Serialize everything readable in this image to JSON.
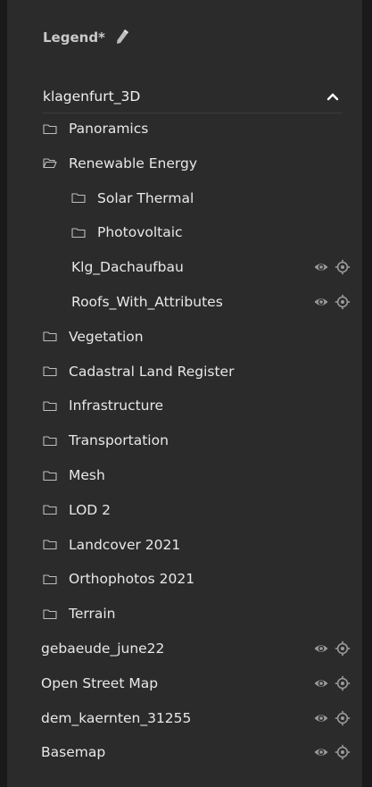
{
  "legend": {
    "title": "Legend*",
    "edit_icon": "pencil-icon"
  },
  "project": {
    "name": "klagenfurt_3D",
    "toggle_icon": "chevron-up-icon"
  },
  "tree": [
    {
      "label": "Panoramics",
      "type": "folder",
      "open": false,
      "indent": 0
    },
    {
      "label": "Renewable Energy",
      "type": "folder",
      "open": true,
      "indent": 0
    },
    {
      "label": "Solar Thermal",
      "type": "folder",
      "open": false,
      "indent": 1
    },
    {
      "label": "Photovoltaic",
      "type": "folder",
      "open": false,
      "indent": 1
    },
    {
      "label": "Klg_Dachaufbau",
      "type": "layer",
      "indent": 1
    },
    {
      "label": "Roofs_With_Attributes",
      "type": "layer",
      "indent": 1
    },
    {
      "label": "Vegetation",
      "type": "folder",
      "open": false,
      "indent": 0
    },
    {
      "label": "Cadastral Land Register",
      "type": "folder",
      "open": false,
      "indent": 0
    },
    {
      "label": "Infrastructure",
      "type": "folder",
      "open": false,
      "indent": 0
    },
    {
      "label": "Transportation",
      "type": "folder",
      "open": false,
      "indent": 0
    },
    {
      "label": "Mesh",
      "type": "folder",
      "open": false,
      "indent": 0
    },
    {
      "label": "LOD 2",
      "type": "folder",
      "open": false,
      "indent": 0
    },
    {
      "label": "Landcover 2021",
      "type": "folder",
      "open": false,
      "indent": 0
    },
    {
      "label": "Orthophotos 2021",
      "type": "folder",
      "open": false,
      "indent": 0
    },
    {
      "label": "Terrain",
      "type": "folder",
      "open": false,
      "indent": 0
    },
    {
      "label": "gebaeude_june22",
      "type": "layer",
      "indent": -1
    },
    {
      "label": "Open Street Map",
      "type": "layer",
      "indent": -1
    },
    {
      "label": "dem_kaernten_31255",
      "type": "layer",
      "indent": -1
    },
    {
      "label": "Basemap",
      "type": "layer",
      "indent": -1
    }
  ],
  "icons": {
    "folder_closed": "folder-icon",
    "folder_open": "folder-open-icon",
    "visibility": "eye-icon",
    "zoom": "locate-icon"
  },
  "colors": {
    "panel_bg": "#2b2b2b",
    "page_bg": "#1a1a1a",
    "text": "#e8e8e8",
    "muted_icon": "#9a9a9a"
  }
}
